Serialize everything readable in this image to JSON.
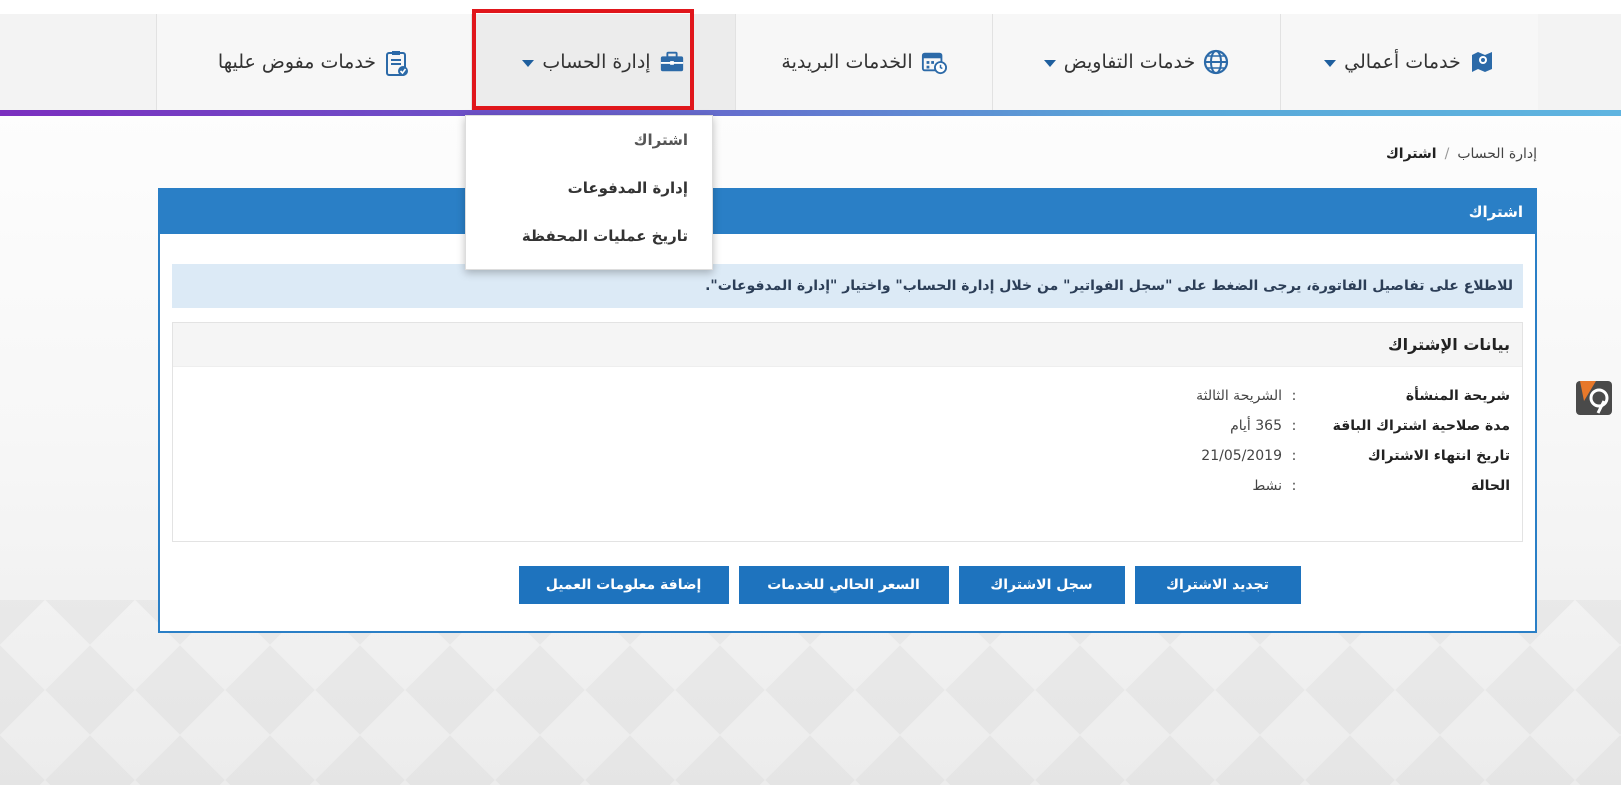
{
  "nav": {
    "items": [
      {
        "label": "خدمات أعمالي",
        "icon": "map-icon",
        "has_caret": true
      },
      {
        "label": "خدمات التفاويض",
        "icon": "globe-icon",
        "has_caret": true
      },
      {
        "label": "الخدمات البريدية",
        "icon": "calendar-clock-icon",
        "has_caret": false
      },
      {
        "label": "إدارة الحساب",
        "icon": "briefcase-icon",
        "has_caret": true
      },
      {
        "label": "خدمات مفوض عليها",
        "icon": "clipboard-check-icon",
        "has_caret": false
      }
    ]
  },
  "dropdown": {
    "items": [
      "اشتراك",
      "إدارة المدفوعات",
      "تاريخ عمليات المحفظة"
    ]
  },
  "breadcrumb": {
    "parent": "إدارة الحساب",
    "separator": "/",
    "current": "اشتراك"
  },
  "panel": {
    "title": "اشتراك",
    "info": "للاطلاع على تفاصيل الفاتورة، يرجى الضغط على \"سجل الفواتير\" من خلال إدارة الحساب\" واختيار \"إدارة المدفوعات\".",
    "subscription": {
      "title": "بيانات الإشتراك",
      "fields": [
        {
          "label": "شريحة المنشأة",
          "value": "الشريحة الثالثة"
        },
        {
          "label": "مدة صلاحية اشتراك الباقة",
          "value": "365 أيام"
        },
        {
          "label": "تاريخ انتهاء الاشتراك",
          "value": "21/05/2019"
        },
        {
          "label": "الحالة",
          "value": "نشط"
        }
      ],
      "colon": ":"
    },
    "buttons": {
      "renew": "تجديد الاشتراك",
      "history": "سجل الاشتراك",
      "price": "السعر الحالي للخدمات",
      "add_client": "إضافة معلومات العميل"
    }
  },
  "colors": {
    "primary": "#2a7fc6",
    "button": "#1e73be",
    "highlight": "#e0161b",
    "info_bg": "#dceaf6"
  }
}
